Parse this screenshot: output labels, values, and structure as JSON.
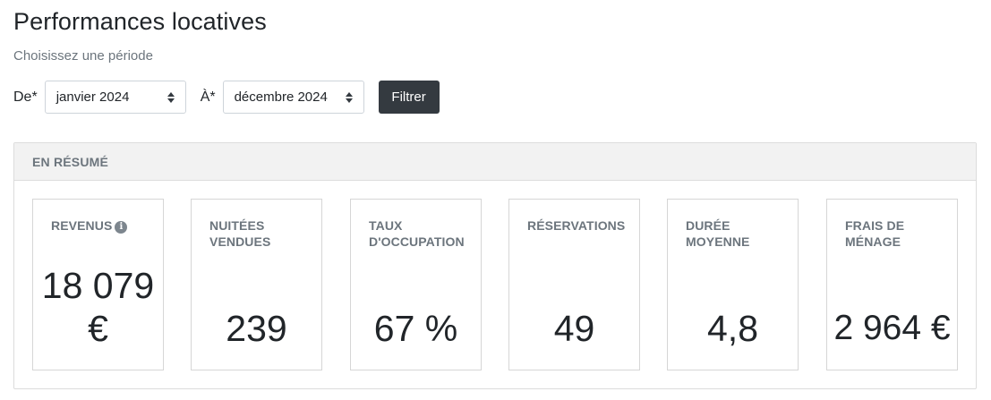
{
  "page": {
    "title": "Performances locatives",
    "subtitle": "Choisissez une période"
  },
  "filter": {
    "from_label": "De*",
    "from_value": "janvier 2024",
    "to_label": "À*",
    "to_value": "décembre 2024",
    "button_label": "Filtrer"
  },
  "summary": {
    "header": "EN RÉSUMÉ",
    "stats": [
      {
        "label": "REVENUS",
        "value": "18 079 €",
        "has_info": true
      },
      {
        "label": "NUITÉES VENDUES",
        "value": "239"
      },
      {
        "label": "TAUX D'OCCUPATION",
        "value": "67 %"
      },
      {
        "label": "RÉSERVATIONS",
        "value": "49"
      },
      {
        "label": "DURÉE MOYENNE",
        "value": "4,8"
      },
      {
        "label": "FRAIS DE MÉNAGE",
        "value": "2 964 €"
      }
    ]
  },
  "icons": {
    "info": "info-icon",
    "select_caret": "sort-caret-icon"
  },
  "colors": {
    "button_bg": "#343a40",
    "muted_text": "#6c757d",
    "header_bg": "#f2f2f2"
  }
}
